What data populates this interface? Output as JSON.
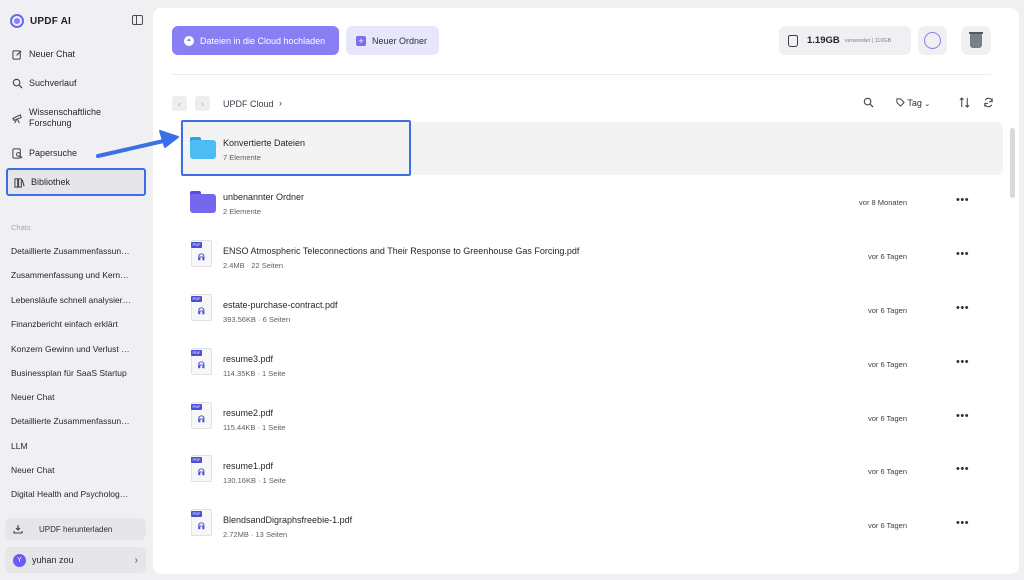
{
  "app": {
    "name": "UPDF AI"
  },
  "sidebar": {
    "nav": [
      {
        "label": "Neuer Chat",
        "icon": "edit-icon"
      },
      {
        "label": "Suchverlauf",
        "icon": "search-icon"
      },
      {
        "label": "Wissenschaftliche Forschung",
        "icon": "telescope-icon"
      },
      {
        "label": "Papersuche",
        "icon": "paper-search-icon"
      },
      {
        "label": "Bibliothek",
        "icon": "library-icon",
        "active": true
      }
    ],
    "chats_title": "Chats",
    "chats": [
      "Detaillierte Zusammenfassun…",
      "Zusammenfassung und Kern…",
      "Lebensläufe schnell analysier…",
      "Finanzbericht einfach erklärt",
      "Konzern Gewinn und Verlust …",
      "Businessplan für SaaS Startup",
      "Neuer Chat",
      "Detaillierte Zusammenfassun…",
      "LLM",
      "Neuer Chat",
      "Digital Health and Psycholog…"
    ],
    "download_label": "UPDF herunterladen",
    "user": {
      "initial": "Y",
      "name": "yuhan zou"
    }
  },
  "toolbar": {
    "upload_label": "Dateien in die Cloud hochladen",
    "new_folder_label": "Neuer Ordner",
    "storage_used": "1.19GB",
    "storage_label": "verwendet | 110GB"
  },
  "breadcrumb": {
    "current": "UPDF Cloud",
    "tag_label": "Tag"
  },
  "files": [
    {
      "type": "folder",
      "name": "Konvertierte Dateien",
      "meta": "7 Elemente",
      "date": "",
      "color": "#3db2f0",
      "highlight": true
    },
    {
      "type": "folder",
      "name": "unbenannter Ordner",
      "meta": "2 Elemente",
      "date": "vor 8 Monaten",
      "color": "#6d62e8"
    },
    {
      "type": "pdf",
      "name": "ENSO Atmospheric Teleconnections and Their Response to Greenhouse Gas Forcing.pdf",
      "meta": "2.4MB · 22 Seiten",
      "date": "vor 6 Tagen"
    },
    {
      "type": "pdf",
      "name": "estate-purchase-contract.pdf",
      "meta": "393.56KB · 6 Seiten",
      "date": "vor 6 Tagen"
    },
    {
      "type": "pdf",
      "name": "resume3.pdf",
      "meta": "114.35KB · 1 Seite",
      "date": "vor 6 Tagen"
    },
    {
      "type": "pdf",
      "name": "resume2.pdf",
      "meta": "115.44KB · 1 Seite",
      "date": "vor 6 Tagen"
    },
    {
      "type": "pdf",
      "name": "resume1.pdf",
      "meta": "130.16KB · 1 Seite",
      "date": "vor 6 Tagen"
    },
    {
      "type": "pdf",
      "name": "BlendsandDigraphsfreebie-1.pdf",
      "meta": "2.72MB · 13 Seiten",
      "date": "vor 6 Tagen"
    }
  ],
  "colors": {
    "accent": "#8a7ef4",
    "highlight_outline": "#3b6fe6"
  }
}
